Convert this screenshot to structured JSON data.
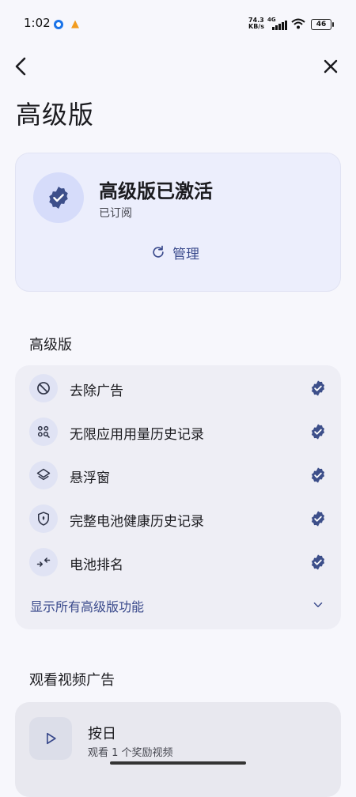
{
  "status_bar": {
    "time": "1:02",
    "net_speed_value": "74.3",
    "net_speed_unit": "KB/s",
    "network": "4G",
    "battery": "46"
  },
  "header": {
    "title": "高级版"
  },
  "status_card": {
    "title": "高级版已激活",
    "subtitle": "已订阅",
    "manage_label": "管理"
  },
  "premium_section": {
    "title": "高级版",
    "features": [
      {
        "label": "去除广告",
        "icon": "block-icon"
      },
      {
        "label": "无限应用用量历史记录",
        "icon": "apps-search-icon"
      },
      {
        "label": "悬浮窗",
        "icon": "layers-icon"
      },
      {
        "label": "完整电池健康历史记录",
        "icon": "shield-icon"
      },
      {
        "label": "电池排名",
        "icon": "compare-arrows-icon"
      }
    ],
    "show_all_label": "显示所有高级版功能"
  },
  "video_section": {
    "title": "观看视频广告",
    "card_title": "按日",
    "card_subtitle": "观看 1 个奖励视频"
  },
  "colors": {
    "accent": "#3a4a8c",
    "badge": "#3d4f8a",
    "background": "#f7f7fc"
  }
}
